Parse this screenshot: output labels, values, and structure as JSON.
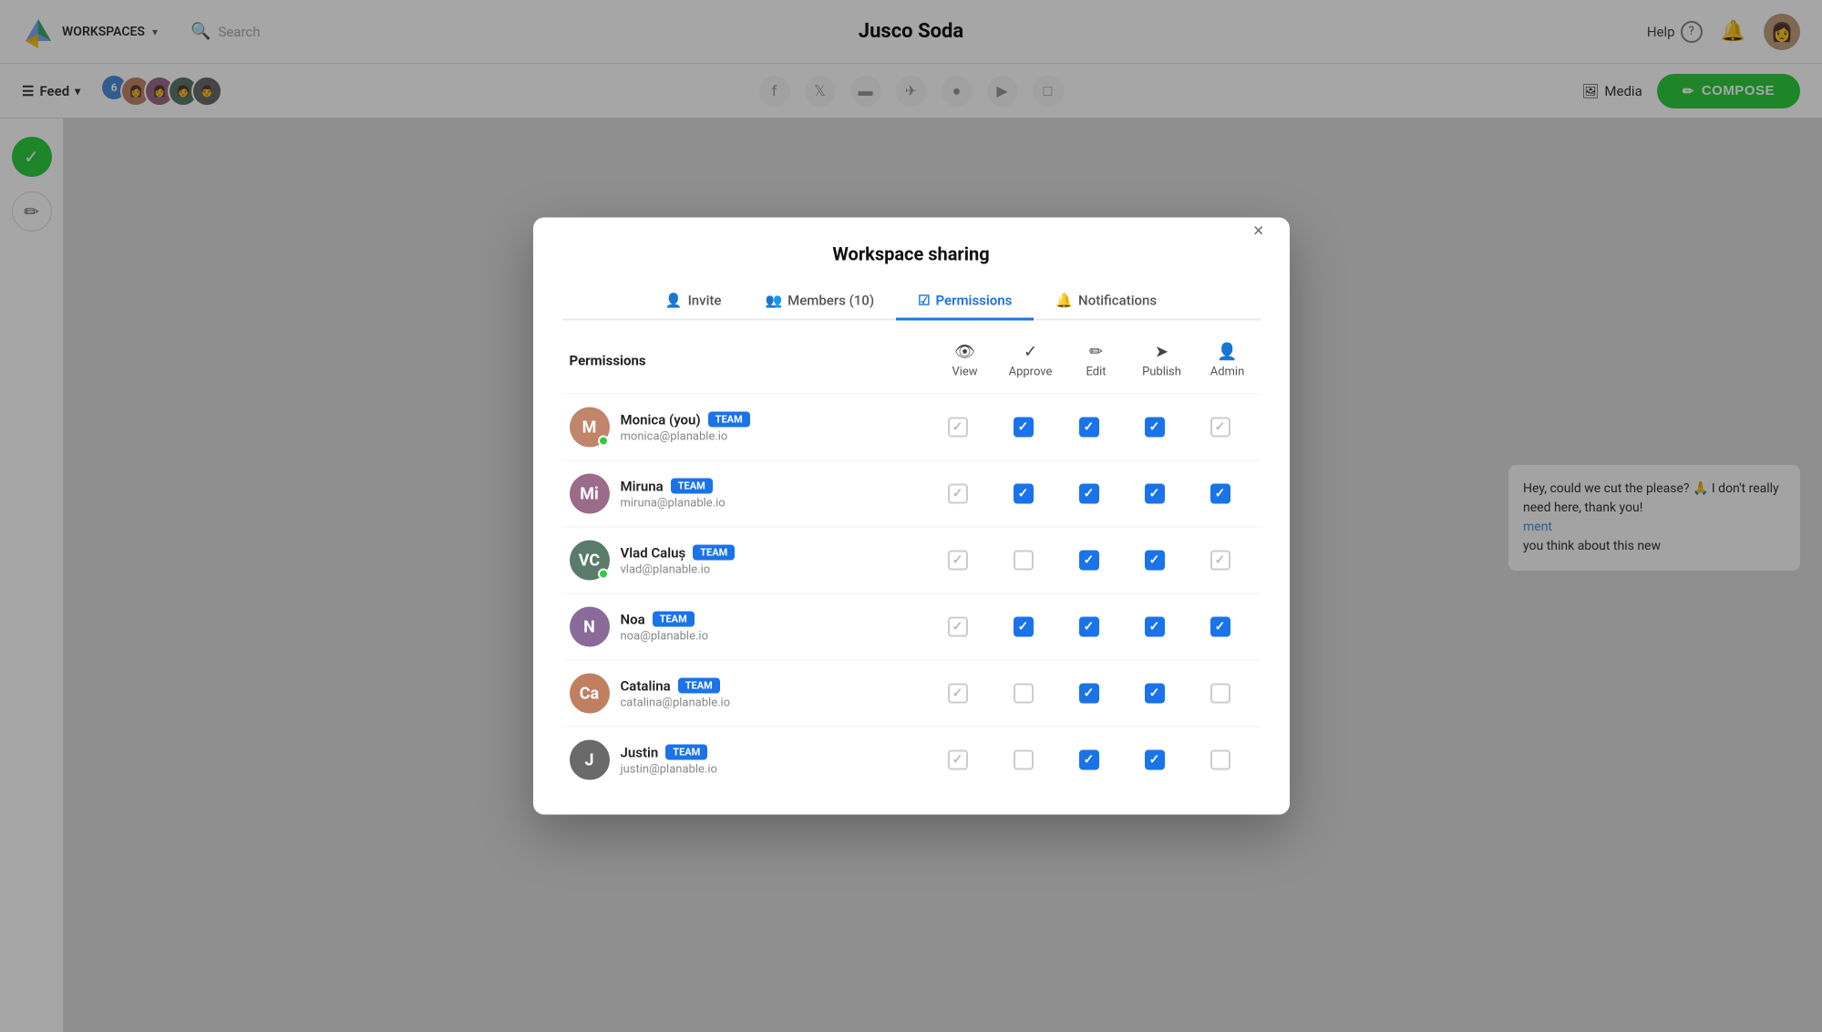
{
  "app": {
    "title": "Jusco Soda",
    "workspaces_label": "WORKSPACES",
    "search_placeholder": "Search",
    "help_label": "Help",
    "feed_label": "Feed",
    "member_count": "6",
    "media_label": "Media",
    "compose_label": "COMPOSE"
  },
  "modal": {
    "title": "Workspace sharing",
    "close_label": "×",
    "tabs": [
      {
        "id": "invite",
        "label": "Invite",
        "icon": "👤"
      },
      {
        "id": "members",
        "label": "Members (10)",
        "icon": "👥"
      },
      {
        "id": "permissions",
        "label": "Permissions",
        "icon": "☑",
        "active": true
      },
      {
        "id": "notifications",
        "label": "Notifications",
        "icon": "🔔"
      }
    ],
    "permissions": {
      "section_label": "Permissions",
      "columns": [
        {
          "id": "view",
          "label": "View",
          "icon": "👁"
        },
        {
          "id": "approve",
          "label": "Approve",
          "icon": "✓"
        },
        {
          "id": "edit",
          "label": "Edit",
          "icon": "✏"
        },
        {
          "id": "publish",
          "label": "Publish",
          "icon": "➤"
        },
        {
          "id": "admin",
          "label": "Admin",
          "icon": "👤"
        }
      ],
      "users": [
        {
          "name": "Monica (you)",
          "badge": "TEAM",
          "email": "monica@planable.io",
          "online": true,
          "avatar_color": "#c0856a",
          "initials": "M",
          "perms": {
            "view": "disabled-checked",
            "approve": "checked-blue",
            "edit": "checked-blue",
            "publish": "checked-blue",
            "admin": "disabled-checked"
          }
        },
        {
          "name": "Miruna",
          "badge": "TEAM",
          "email": "miruna@planable.io",
          "online": false,
          "avatar_color": "#9b6b8a",
          "initials": "Mi",
          "perms": {
            "view": "disabled-checked",
            "approve": "checked-blue",
            "edit": "checked-blue",
            "publish": "checked-blue",
            "admin": "checked-blue"
          }
        },
        {
          "name": "Vlad Caluș",
          "badge": "TEAM",
          "email": "vlad@planable.io",
          "online": true,
          "avatar_color": "#5a7a6a",
          "initials": "VC",
          "perms": {
            "view": "disabled-checked",
            "approve": "unchecked",
            "edit": "checked-blue",
            "publish": "checked-blue",
            "admin": "disabled-checked"
          }
        },
        {
          "name": "Noa",
          "badge": "TEAM",
          "email": "noa@planable.io",
          "online": false,
          "avatar_color": "#8a6a9b",
          "initials": "N",
          "perms": {
            "view": "disabled-checked",
            "approve": "checked-blue",
            "edit": "checked-blue",
            "publish": "checked-blue",
            "admin": "checked-blue"
          }
        },
        {
          "name": "Catalina",
          "badge": "TEAM",
          "email": "catalina@planable.io",
          "online": false,
          "avatar_color": "#c08060",
          "initials": "Ca",
          "perms": {
            "view": "disabled-checked",
            "approve": "unchecked",
            "edit": "checked-blue",
            "publish": "checked-blue",
            "admin": "unchecked"
          }
        },
        {
          "name": "Justin",
          "badge": "TEAM",
          "email": "justin@planable.io",
          "online": false,
          "avatar_color": "#6a6a6a",
          "initials": "J",
          "perms": {
            "view": "disabled-checked",
            "approve": "unchecked",
            "edit": "checked-blue",
            "publish": "checked-blue",
            "admin": "unchecked"
          }
        }
      ]
    }
  },
  "sidebar": {
    "icons": [
      "✓",
      "✏"
    ]
  },
  "content_preview": {
    "comment": "Hey, could we cut the please? 🙏 I don't really need here, thank you!",
    "link": "ment",
    "second_text": "you think about this new"
  }
}
